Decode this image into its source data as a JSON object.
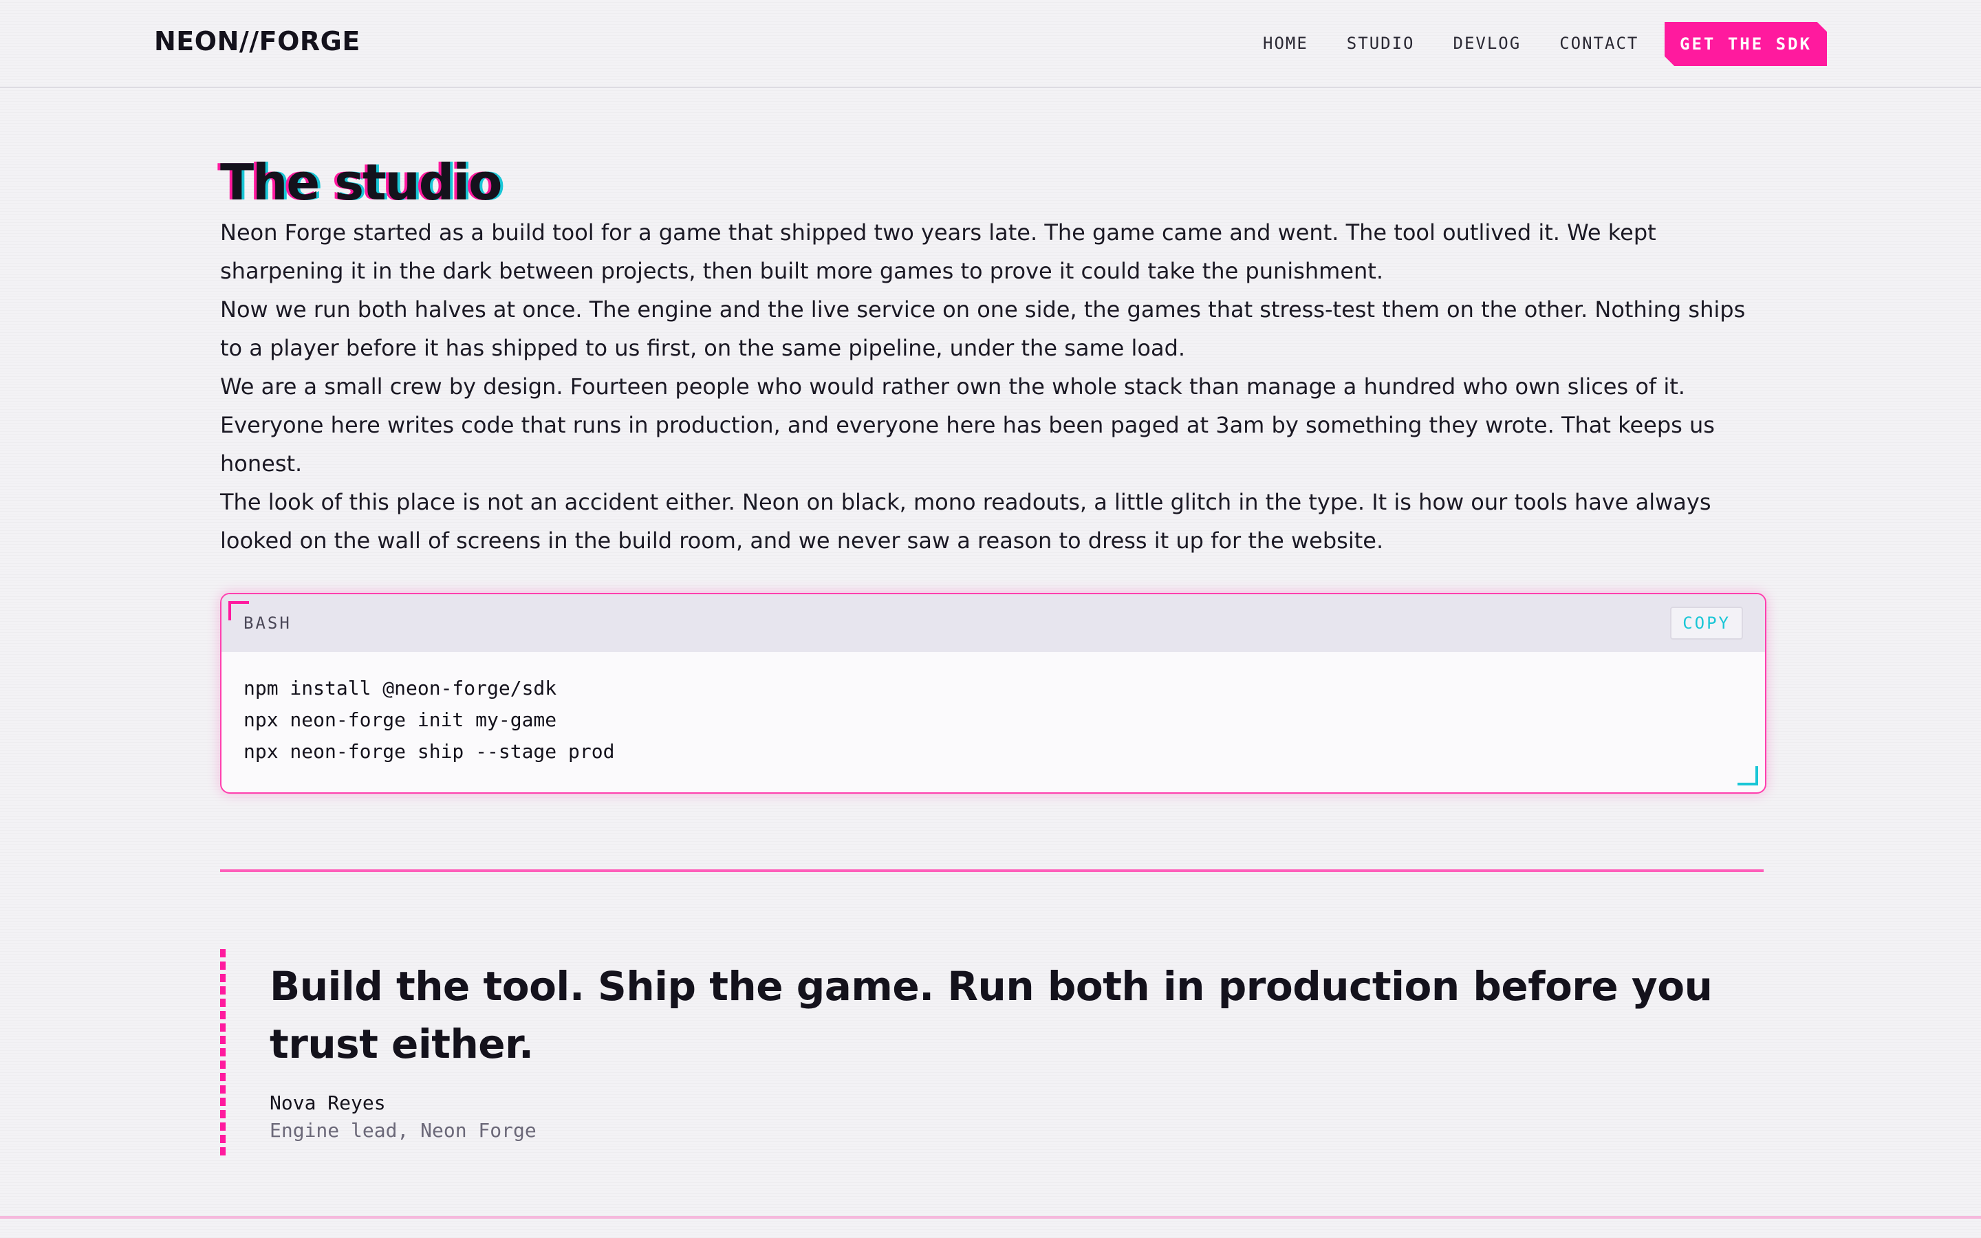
{
  "header": {
    "logo": "NEON//FORGE",
    "nav": [
      "HOME",
      "STUDIO",
      "DEVLOG",
      "CONTACT"
    ],
    "cta_label": "GET THE SDK"
  },
  "main": {
    "title": "The studio",
    "paragraphs": [
      "Neon Forge started as a build tool for a game that shipped two years late. The game came and went. The tool outlived it. We kept sharpening it in the dark between projects, then built more games to prove it could take the punishment.",
      "Now we run both halves at once. The engine and the live service on one side, the games that stress-test them on the other. Nothing ships to a player before it has shipped to us first, on the same pipeline, under the same load.",
      "We are a small crew by design. Fourteen people who would rather own the whole stack than manage a hundred who own slices of it. Everyone here writes code that runs in production, and everyone here has been paged at 3am by something they wrote. That keeps us honest.",
      "The look of this place is not an accident either. Neon on black, mono readouts, a little glitch in the type. It is how our tools have always looked on the wall of screens in the build room, and we never saw a reason to dress it up for the website."
    ],
    "code": {
      "language": "BASH",
      "copy_label": "COPY",
      "lines": [
        "npm install @neon-forge/sdk",
        "npx neon-forge init my-game",
        "npx neon-forge ship --stage prod"
      ]
    },
    "quote": {
      "text": "Build the tool. Ship the game. Run both in production before you trust either.",
      "author": "Nova Reyes",
      "role": "Engine lead, Neon Forge"
    }
  },
  "colors": {
    "accent_pink": "#ff1a9e",
    "accent_cyan": "#19c6d6",
    "background": "#f3f2f5",
    "text": "#14121c"
  },
  "icons": [
    "corner-bracket-pink",
    "corner-bracket-cyan"
  ]
}
